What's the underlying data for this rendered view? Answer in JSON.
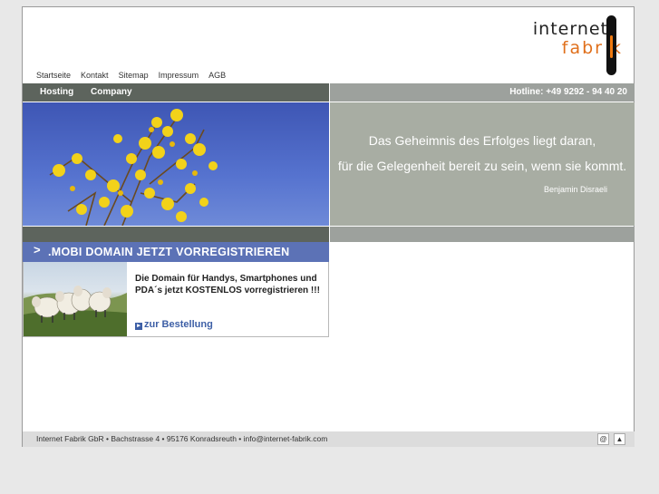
{
  "logo": {
    "line1": "internet",
    "line2": "fabr  k"
  },
  "topnav": [
    "Startseite",
    "Kontakt",
    "Sitemap",
    "Impressum",
    "AGB"
  ],
  "mainnav": {
    "hosting": "Hosting",
    "company": "Company"
  },
  "hotline": "Hotline: +49 9292 - 94 40 20",
  "quote": {
    "line1": "Das Geheimnis des Erfolges liegt daran,",
    "line2": "für die Gelegenheit bereit zu sein, wenn sie kommt.",
    "author": "Benjamin Disraeli"
  },
  "mobi": {
    "arrow": ">",
    "title": ".MOBI DOMAIN JETZT VORREGISTRIEREN",
    "text": "Die Domain für Handys, Smartphones und PDA´s jetzt KOSTENLOS vorregistrieren !!!",
    "order_icon": "▸",
    "order_link": "zur Bestellung"
  },
  "footer": {
    "address": "Internet Fabrik GbR • Bachstrasse 4 • 95176 Konradsreuth • info@internet-fabrik.com",
    "email_icon": "@",
    "top_icon": "▲"
  },
  "colors": {
    "accent": "#e0701c",
    "nav": "#5d645d",
    "mobi": "#5c72b6",
    "link": "#3d5fa6"
  }
}
